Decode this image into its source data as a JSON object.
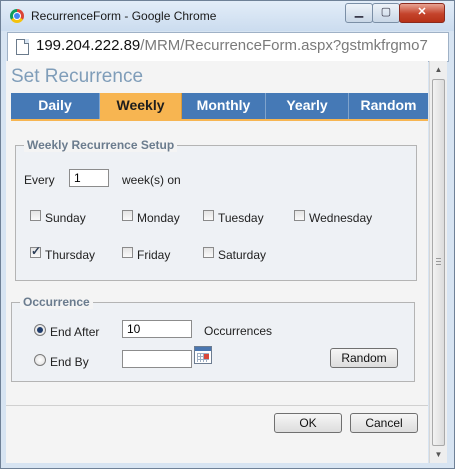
{
  "window": {
    "title": "RecurrenceForm - Google Chrome"
  },
  "address": {
    "host": "199.204.222.89",
    "path": "/MRM/RecurrenceForm.aspx?gstmkfrgmo7"
  },
  "page": {
    "title": "Set Recurrence"
  },
  "tabs": [
    {
      "label": "Daily",
      "active": false
    },
    {
      "label": "Weekly",
      "active": true
    },
    {
      "label": "Monthly",
      "active": false
    },
    {
      "label": "Yearly",
      "active": false
    },
    {
      "label": "Random",
      "active": false
    }
  ],
  "weekly": {
    "legend": "Weekly Recurrence Setup",
    "every_label": "Every",
    "every_value": "1",
    "weeks_on_label": "week(s) on",
    "days": [
      {
        "label": "Sunday",
        "checked": false
      },
      {
        "label": "Monday",
        "checked": false
      },
      {
        "label": "Tuesday",
        "checked": false
      },
      {
        "label": "Wednesday",
        "checked": false
      },
      {
        "label": "Thursday",
        "checked": true
      },
      {
        "label": "Friday",
        "checked": false
      },
      {
        "label": "Saturday",
        "checked": false
      }
    ]
  },
  "occurrence": {
    "legend": "Occurrence",
    "end_after_label": "End After",
    "end_after_value": "10",
    "end_after_selected": true,
    "occurrences_label": "Occurrences",
    "end_by_label": "End By",
    "end_by_value": "",
    "random_button": "Random"
  },
  "buttons": {
    "ok": "OK",
    "cancel": "Cancel"
  },
  "icons": {
    "browser": "chrome-logo-icon",
    "page": "page-icon",
    "calendar": "calendar-icon",
    "scroll_up": "scroll-up-arrow-icon",
    "scroll_down": "scroll-down-arrow-icon"
  },
  "colors": {
    "tab_bar": "#4579b6",
    "tab_active": "#f7b551",
    "page_title": "#7f9db9",
    "legend": "#6b7c8e"
  }
}
